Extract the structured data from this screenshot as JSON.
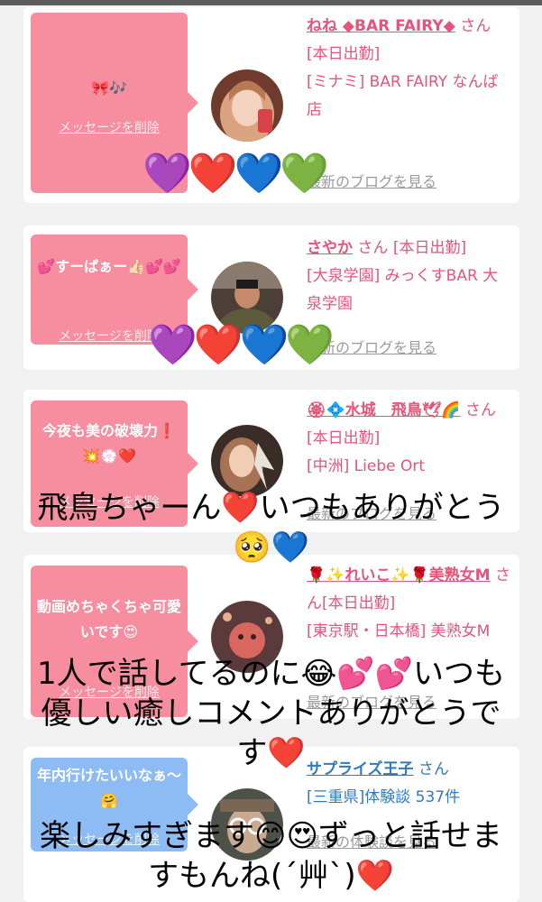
{
  "cards": [
    {
      "message": "🎀🎶",
      "delete_label": "メッセージを削除",
      "name": "ねね ◆BAR FAIRY◆",
      "san": "さん",
      "status": "[本日出勤]",
      "shop": "[ミナミ] BAR FAIRY なんば店",
      "blog_label": "最新のブログを見る"
    },
    {
      "message": "💕すーぱぁー👍🏻💕💕",
      "delete_label": "メッセージを削除",
      "name": "さやか",
      "san": "さん",
      "status": "[本日出勤]",
      "shop": "[大泉学園] みっくすBAR 大泉学園",
      "blog_label": "最新のブログを見る"
    },
    {
      "message": "今夜も美の破壊力❗️💥💮❤️",
      "delete_label": "メッセージを削除",
      "name": "🏵💠水城　飛鳥🕊🌈",
      "san": "さん",
      "status": "[本日出勤]",
      "shop": "[中洲] Liebe Ort",
      "blog_label": "最新のブログを見る"
    },
    {
      "message": "動画めちゃくちゃ可愛いです😍",
      "delete_label": "メッセージを削除",
      "name": "🌹✨れいこ✨🌹美熟女M",
      "san": "さん",
      "status": "[本日出勤]",
      "shop": "[東京駅・日本橋] 美熟女M",
      "blog_label": "最新のブログを見る"
    },
    {
      "message": "年内行けたいいなぁ〜🤗",
      "delete_label": "メッセージを削除",
      "name": "サプライズ王子",
      "san": "さん",
      "status": "",
      "shop": "[三重県]体験談 537件",
      "blog_label": "最新の体験談を見る"
    }
  ],
  "sticker_hearts": "💜❤️💙💚",
  "captions": {
    "c1_line1": "飛鳥ちゃーん❤️いつもありがとう",
    "c1_line2": "🥺💙",
    "c2_line1": "1人で話してるのに😂💕💕いつも",
    "c2_line2": "優しい癒しコメントありがとうで",
    "c2_line3": "す❤️",
    "c3_line1": "楽しみすぎます😊😍ずっと話せま",
    "c3_line2": "すもんね(´艸`)❤️"
  },
  "colors": {
    "bubble_pink": "#f78ea0",
    "bubble_blue": "#8cbcf3",
    "name_pink": "#e8537a",
    "name_blue": "#2f79c0"
  }
}
